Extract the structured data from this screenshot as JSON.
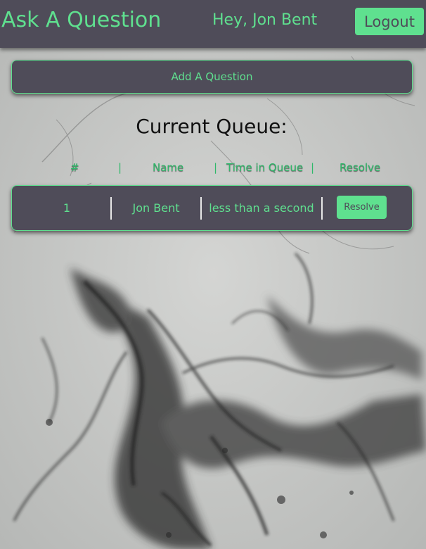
{
  "navbar": {
    "brand": "Ask A Question",
    "greeting": "Hey, Jon Bent",
    "logout_label": "Logout"
  },
  "add_question_label": "Add A Question",
  "queue": {
    "title": "Current Queue:",
    "columns": [
      "#",
      "Name",
      "Time in Queue",
      "Resolve"
    ],
    "separator": "|",
    "rows": [
      {
        "number": "1",
        "name": "Jon Bent",
        "time": "less than a second",
        "resolve_label": "Resolve"
      }
    ]
  },
  "colors": {
    "accent": "#5fe08f",
    "panel": "#4f4c59",
    "background": "#c9cac8"
  },
  "background_image": "ink-smoke-texture"
}
